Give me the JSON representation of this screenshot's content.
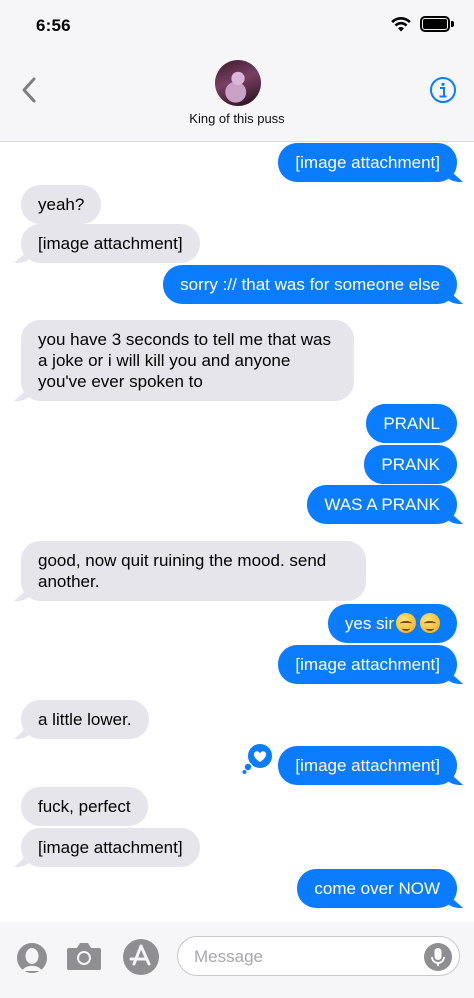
{
  "status_bar": {
    "time": "6:56"
  },
  "nav": {
    "contact_name": "King of this puss"
  },
  "messages": [
    {
      "from": "me",
      "text": "[image attachment]"
    },
    {
      "from": "them",
      "text": "yeah?"
    },
    {
      "from": "them",
      "text": "[image attachment]"
    },
    {
      "from": "me",
      "text": "sorry :// that was for someone else"
    },
    {
      "from": "them",
      "text": "you have 3 seconds to tell me that was a joke or i will kill you and anyone you've ever spoken to"
    },
    {
      "from": "me",
      "text": "PRANL"
    },
    {
      "from": "me",
      "text": "PRANK"
    },
    {
      "from": "me",
      "text": "WAS A PRANK"
    },
    {
      "from": "them",
      "text": "good, now quit ruining the mood. send another."
    },
    {
      "from": "me",
      "text": "yes sir"
    },
    {
      "from": "me",
      "text": "[image attachment]"
    },
    {
      "from": "them",
      "text": "a little lower."
    },
    {
      "from": "me",
      "text": "[image attachment]",
      "reaction": "heart"
    },
    {
      "from": "them",
      "text": "fuck, perfect"
    },
    {
      "from": "them",
      "text": "[image attachment]"
    },
    {
      "from": "me",
      "text": "come over NOW"
    }
  ],
  "composer": {
    "placeholder": "Message"
  },
  "colors": {
    "outgoing": "#0a7cff",
    "incoming": "#e6e5eb",
    "accent": "#0a7cff"
  },
  "icons": [
    "back-chevron-icon",
    "info-icon",
    "wifi-icon",
    "battery-icon",
    "memoji-icon",
    "camera-icon",
    "app-store-icon",
    "microphone-icon",
    "heart-reaction-icon",
    "pensive-face-emoji"
  ]
}
